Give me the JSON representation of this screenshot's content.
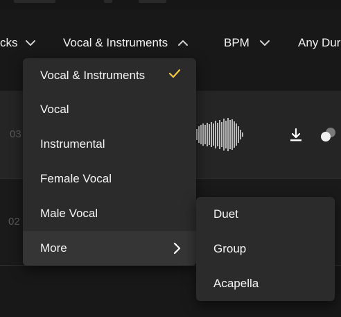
{
  "filters": {
    "tracks_partial": "cks",
    "vocal": "Vocal & Instruments",
    "bpm": "BPM",
    "duration_partial": "Any Dur"
  },
  "tracks": [
    {
      "number_partial": "03"
    },
    {
      "number_partial": "02"
    }
  ],
  "vocal_menu": {
    "items": [
      "Vocal & Instruments",
      "Vocal",
      "Instrumental",
      "Female Vocal",
      "Male Vocal",
      "More"
    ],
    "selected_index": 0,
    "check_color": "#f5c842"
  },
  "more_submenu": {
    "items": [
      "Duet",
      "Group",
      "Acapella"
    ]
  },
  "icons": {
    "selected": "check-icon",
    "submenu": "chevron-right-icon",
    "download": "download-icon",
    "more": "toggle-dots-icon"
  }
}
